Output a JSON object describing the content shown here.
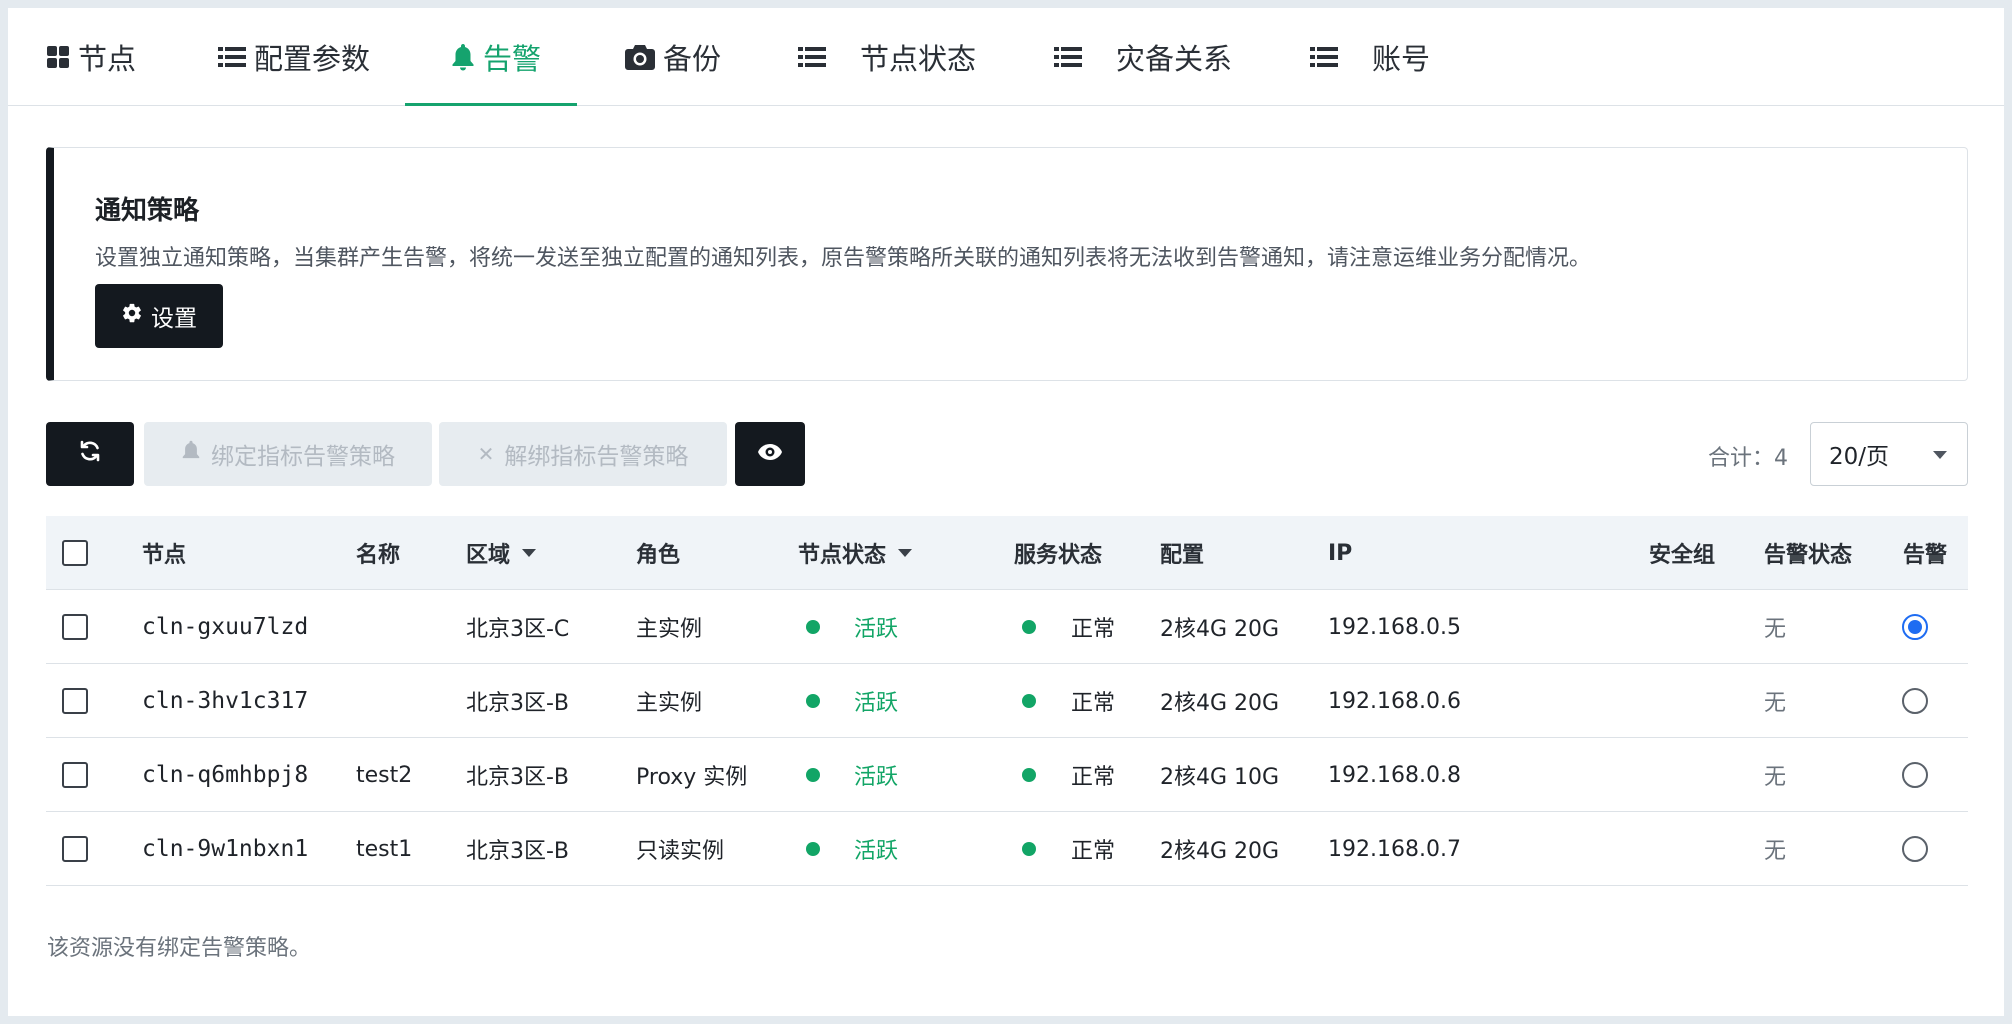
{
  "tabs": [
    {
      "label": "节点",
      "icon": "grid-icon"
    },
    {
      "label": "配置参数",
      "icon": "list-icon"
    },
    {
      "label": "告警",
      "icon": "bell-icon",
      "active": true
    },
    {
      "label": "备份",
      "icon": "camera-icon"
    },
    {
      "label": "节点状态",
      "icon": "list-icon"
    },
    {
      "label": "灾备关系",
      "icon": "list-icon"
    },
    {
      "label": "账号",
      "icon": "list-icon"
    }
  ],
  "notice": {
    "title": "通知策略",
    "description": "设置独立通知策略，当集群产生告警，将统一发送至独立配置的通知列表，原告警策略所关联的通知列表将无法收到告警通知，请注意运维业务分配情况。",
    "settings_label": "设置"
  },
  "toolbar": {
    "refresh_icon": "refresh-icon",
    "bind_label": "绑定指标告警策略",
    "unbind_label": "解绑指标告警策略",
    "view_icon": "eye-icon",
    "total_label": "合计：4",
    "page_size": "20/页"
  },
  "table": {
    "headers": {
      "node": "节点",
      "name": "名称",
      "zone": "区域",
      "role": "角色",
      "node_status": "节点状态",
      "service_status": "服务状态",
      "config": "配置",
      "ip": "IP",
      "security_group": "安全组",
      "alarm_status": "告警状态",
      "alarm": "告警"
    },
    "rows": [
      {
        "node": "cln-gxuu7lzd",
        "name": "",
        "zone": "北京3区-C",
        "role": "主实例",
        "node_status": "活跃",
        "service_status": "正常",
        "config": "2核4G 20G",
        "ip": "192.168.0.5",
        "alarm_status": "无",
        "selected": true
      },
      {
        "node": "cln-3hv1c317",
        "name": "",
        "zone": "北京3区-B",
        "role": "主实例",
        "node_status": "活跃",
        "service_status": "正常",
        "config": "2核4G 20G",
        "ip": "192.168.0.6",
        "alarm_status": "无",
        "selected": false
      },
      {
        "node": "cln-q6mhbpj8",
        "name": "test2",
        "zone": "北京3区-B",
        "role": "Proxy 实例",
        "node_status": "活跃",
        "service_status": "正常",
        "config": "2核4G 10G",
        "ip": "192.168.0.8",
        "alarm_status": "无",
        "selected": false
      },
      {
        "node": "cln-9w1nbxn1",
        "name": "test1",
        "zone": "北京3区-B",
        "role": "只读实例",
        "node_status": "活跃",
        "service_status": "正常",
        "config": "2核4G 20G",
        "ip": "192.168.0.7",
        "alarm_status": "无",
        "selected": false
      }
    ]
  },
  "footer_note": "该资源没有绑定告警策略。",
  "colors": {
    "accent_green": "#15a36e",
    "dark_button": "#14191f",
    "radio_blue": "#1e6cf2"
  }
}
